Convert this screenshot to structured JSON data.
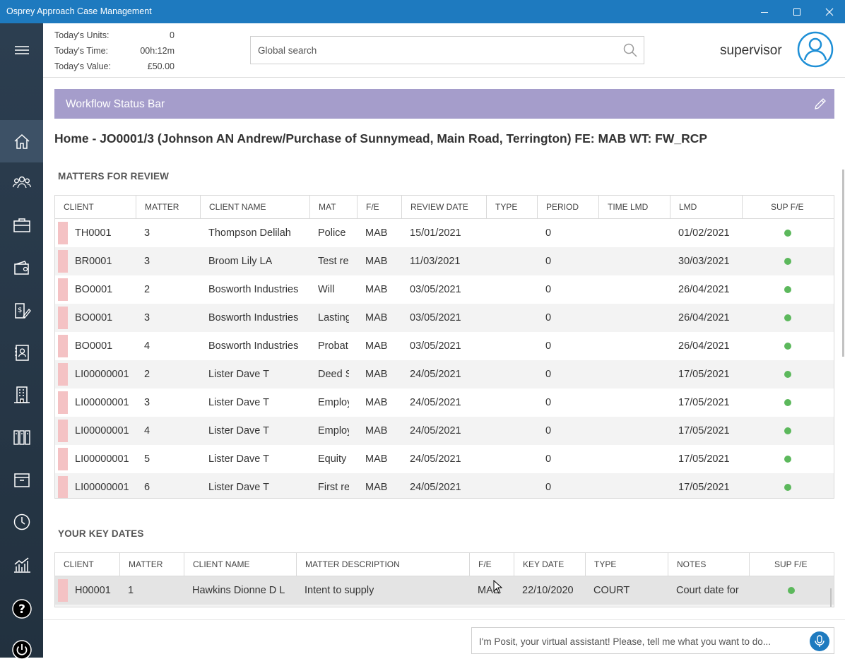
{
  "window": {
    "title": "Osprey Approach Case Management"
  },
  "stats": {
    "units_label": "Today's Units:",
    "units_value": "0",
    "time_label": "Today's Time:",
    "time_value": "00h:12m",
    "value_label": "Today's Value:",
    "value_value": "£50.00"
  },
  "search": {
    "placeholder": "Global search"
  },
  "user": {
    "name": "supervisor"
  },
  "workflow": {
    "title": "Workflow Status Bar"
  },
  "breadcrumb": "Home - JO0001/3 (Johnson AN Andrew/Purchase of Sunnymead, Main Road, Terrington) FE: MAB WT: FW_RCP",
  "review": {
    "title": "MATTERS FOR REVIEW",
    "headers": [
      "CLIENT",
      "MATTER",
      "CLIENT NAME",
      "MAT",
      "F/E",
      "REVIEW DATE",
      "TYPE",
      "PERIOD",
      "TIME LMD",
      "LMD",
      "SUP F/E"
    ],
    "rows": [
      {
        "client": "TH0001",
        "matter": "3",
        "name": "Thompson Delilah",
        "mat": "Police",
        "fe": "MAB",
        "review_date": "15/01/2021",
        "type": "",
        "period": "0",
        "time_lmd": "",
        "lmd": "01/02/2021"
      },
      {
        "client": "BR0001",
        "matter": "3",
        "name": "Broom Lily LA",
        "mat": "Test re",
        "fe": "MAB",
        "review_date": "11/03/2021",
        "type": "",
        "period": "0",
        "time_lmd": "",
        "lmd": "30/03/2021"
      },
      {
        "client": "BO0001",
        "matter": "2",
        "name": "Bosworth Industries",
        "mat": "Will",
        "fe": "MAB",
        "review_date": "03/05/2021",
        "type": "",
        "period": "0",
        "time_lmd": "",
        "lmd": "26/04/2021"
      },
      {
        "client": "BO0001",
        "matter": "3",
        "name": "Bosworth Industries",
        "mat": "Lasting",
        "fe": "MAB",
        "review_date": "03/05/2021",
        "type": "",
        "period": "0",
        "time_lmd": "",
        "lmd": "26/04/2021"
      },
      {
        "client": "BO0001",
        "matter": "4",
        "name": "Bosworth Industries",
        "mat": "Probat",
        "fe": "MAB",
        "review_date": "03/05/2021",
        "type": "",
        "period": "0",
        "time_lmd": "",
        "lmd": "26/04/2021"
      },
      {
        "client": "LI00000001",
        "matter": "2",
        "name": "Lister Dave T",
        "mat": "Deed S",
        "fe": "MAB",
        "review_date": "24/05/2021",
        "type": "",
        "period": "0",
        "time_lmd": "",
        "lmd": "17/05/2021"
      },
      {
        "client": "LI00000001",
        "matter": "3",
        "name": "Lister Dave T",
        "mat": "Employ",
        "fe": "MAB",
        "review_date": "24/05/2021",
        "type": "",
        "period": "0",
        "time_lmd": "",
        "lmd": "17/05/2021"
      },
      {
        "client": "LI00000001",
        "matter": "4",
        "name": "Lister Dave T",
        "mat": "Employ",
        "fe": "MAB",
        "review_date": "24/05/2021",
        "type": "",
        "period": "0",
        "time_lmd": "",
        "lmd": "17/05/2021"
      },
      {
        "client": "LI00000001",
        "matter": "5",
        "name": "Lister Dave T",
        "mat": "Equity",
        "fe": "MAB",
        "review_date": "24/05/2021",
        "type": "",
        "period": "0",
        "time_lmd": "",
        "lmd": "17/05/2021"
      },
      {
        "client": "LI00000001",
        "matter": "6",
        "name": "Lister Dave T",
        "mat": "First re",
        "fe": "MAB",
        "review_date": "24/05/2021",
        "type": "",
        "period": "0",
        "time_lmd": "",
        "lmd": "17/05/2021"
      }
    ]
  },
  "keydates": {
    "title": "YOUR KEY DATES",
    "headers": [
      "CLIENT",
      "MATTER",
      "CLIENT NAME",
      "MATTER DESCRIPTION",
      "F/E",
      "KEY DATE",
      "TYPE",
      "NOTES",
      "SUP F/E"
    ],
    "rows": [
      {
        "client": "H00001",
        "matter": "1",
        "name": "Hawkins Dionne D L",
        "description": "Intent to supply",
        "fe": "MAB",
        "key_date": "22/10/2020",
        "type": "COURT",
        "notes": "Court date for"
      }
    ]
  },
  "assistant": {
    "placeholder": "I'm Posit, your virtual assistant! Please, tell me what you want to do..."
  },
  "sidebar_icons": [
    "menu-icon",
    "home-icon",
    "people-icon",
    "briefcase-icon",
    "wallet-icon",
    "billing-icon",
    "contacts-icon",
    "building-icon",
    "archive-boxes-icon",
    "box-icon",
    "clock-icon",
    "chart-icon",
    "help-icon",
    "power-icon"
  ],
  "colors": {
    "titlebar": "#1e7abf",
    "sidebar": "#2c3e50",
    "workflow_bar": "#a59dcb",
    "status_dot": "#5cb85c",
    "row_flag": "#f4c2c4"
  }
}
